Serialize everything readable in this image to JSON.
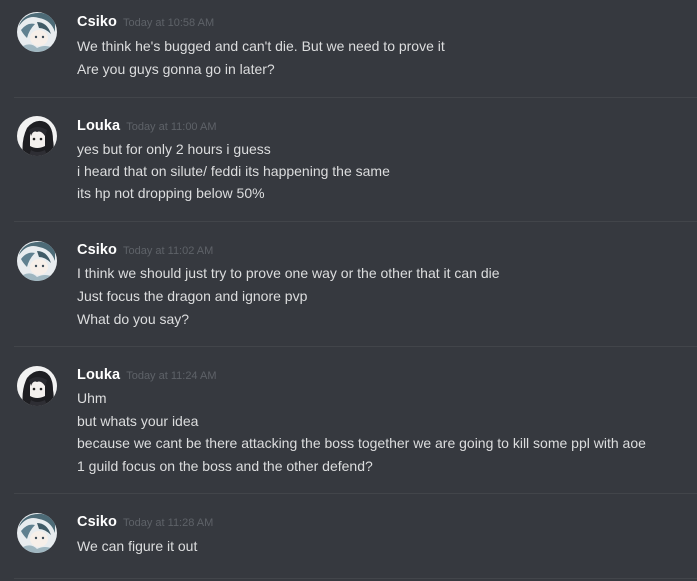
{
  "messages": [
    {
      "author": "Csiko",
      "time": "Today at 10:58 AM",
      "avatar_icon": "anime-girl-avatar",
      "lines": [
        "We think he's bugged and can't die. But we need to prove it",
        "Are you guys gonna go in later?"
      ]
    },
    {
      "author": "Louka",
      "time": "Today at 11:00 AM",
      "avatar_icon": "dark-hair-avatar",
      "lines": [
        "yes but for only 2 hours i guess",
        "i heard that on silute/ feddi its happening the same",
        "its hp not dropping below 50%"
      ]
    },
    {
      "author": "Csiko",
      "time": "Today at 11:02 AM",
      "avatar_icon": "anime-girl-avatar",
      "lines": [
        "I think we should just try to prove one way or the other that it can die",
        "Just focus the dragon and ignore pvp",
        "What do you say?"
      ]
    },
    {
      "author": "Louka",
      "time": "Today at 11:24 AM",
      "avatar_icon": "dark-hair-avatar",
      "lines": [
        "Uhm",
        "but whats your idea",
        "because we cant be there attacking the boss together we are going to kill some ppl with aoe",
        "1 guild focus on the boss and the other defend?"
      ]
    },
    {
      "author": "Csiko",
      "time": "Today at 11:28 AM",
      "avatar_icon": "anime-girl-avatar",
      "lines": [
        "We can figure it out"
      ]
    }
  ],
  "colors": {
    "background": "#36393f",
    "username": "#ffffff",
    "message_text": "#dcddde",
    "timestamp": "#5e6268",
    "divider": "#42454a"
  }
}
